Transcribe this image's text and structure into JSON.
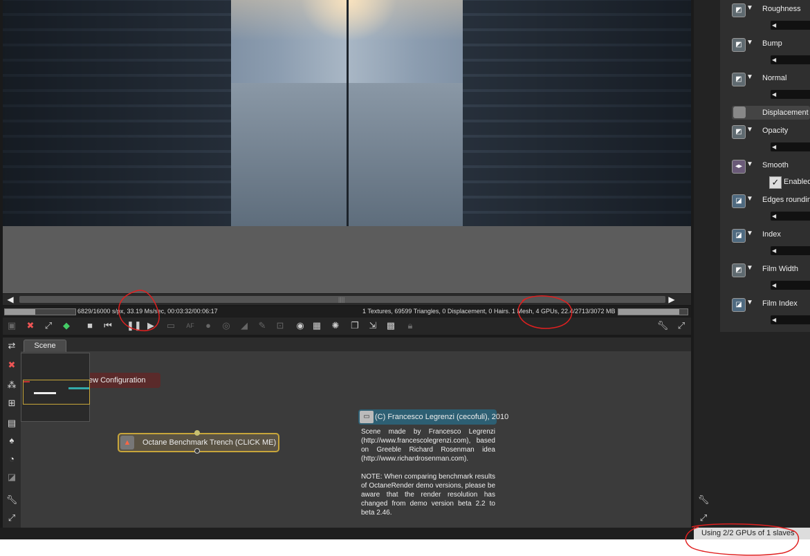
{
  "viewport": {
    "progress": 0.43,
    "memory_fill": 0.88
  },
  "status": {
    "samples_text": "6829/16000 s/px, 33.19 Ms/sec, 00:03:32/00:06:17",
    "scene_info": "1 Textures, 69599 Triangles, 0 Displacement, 0 Hairs. 1 Mesh, 4 GPUs, 22.4/2713/3072 MB"
  },
  "toolbar": {
    "icons": [
      "screenshot-icon",
      "clear-icon",
      "region-icon",
      "cube-icon",
      "stop-icon",
      "restart-icon",
      "pause-icon",
      "play-icon",
      "display-icon",
      "af-icon",
      "color-icon",
      "aperture-icon",
      "focus-icon",
      "picker-icon",
      "crop-icon",
      "zoom-icon",
      "grid-icon",
      "exposure-icon",
      "copy-icon",
      "export-icon",
      "checker-icon",
      "lock-icon",
      "wrench-icon",
      "expand-icon"
    ],
    "af_label": "AF"
  },
  "graph": {
    "tab": "Scene",
    "config_node": "ew Configuration",
    "main_node": "Octane Benchmark Trench (CLICK ME)",
    "comment_title": "(C) Francesco Legrenzi (cecofuli), 2010",
    "comment_p1": "Scene made by Francesco Legrenzi (http://www.francescolegrenzi.com), based on Greeble Richard Rosenman idea (http://www.richardrosenman.com).",
    "comment_p2": "NOTE: When comparing benchmark results of OctaneRender demo versions, please be aware that the render resolution has changed from demo version beta 2.2 to beta 2.46."
  },
  "attributes": {
    "rows": [
      {
        "label": "Roughness"
      },
      {
        "label": "Bump"
      },
      {
        "label": "Normal"
      },
      {
        "label": "Opacity"
      },
      {
        "label": "Smooth"
      },
      {
        "label": "Edges rounding"
      },
      {
        "label": "Index"
      },
      {
        "label": "Film Width"
      },
      {
        "label": "Film Index"
      }
    ],
    "displacement": "Displacement",
    "enabled_label": "Enabled",
    "enabled": true
  },
  "footer": {
    "gpu_status": "Using 2/2 GPUs of 1 slaves"
  },
  "colors": {
    "annotation": "#e02020",
    "node_border": "#c8a63a",
    "comment_header": "#2d5f73"
  }
}
